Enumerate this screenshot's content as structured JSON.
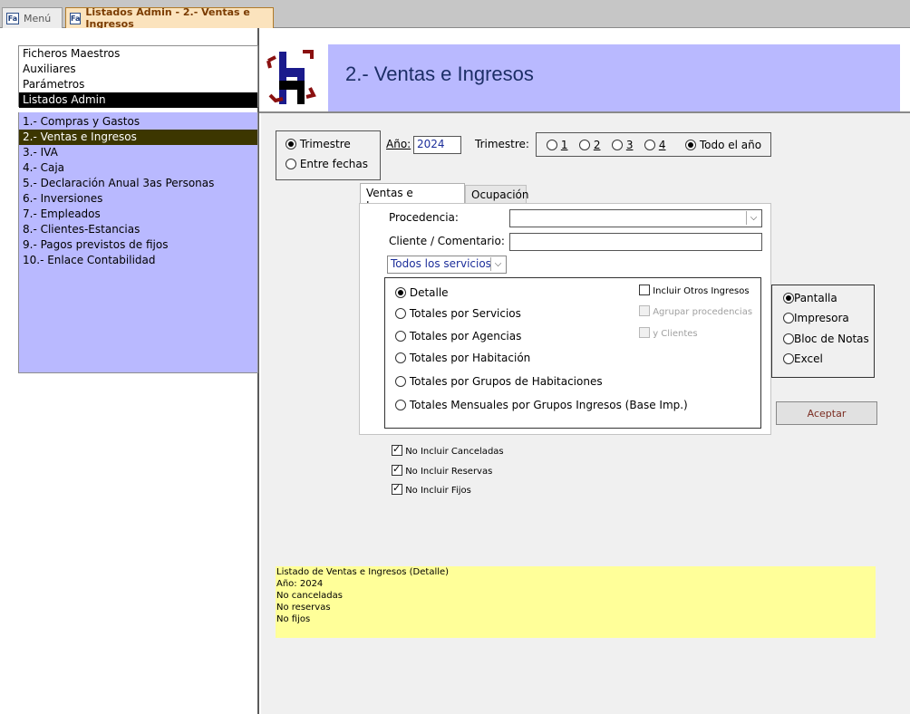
{
  "tabs": [
    {
      "label": "Menú"
    },
    {
      "label": "Listados Admin - 2.- Ventas e Ingresos"
    }
  ],
  "sidebar": {
    "main_items": [
      {
        "label": "Ficheros Maestros"
      },
      {
        "label": "Auxiliares"
      },
      {
        "label": "Parámetros"
      },
      {
        "label": "Listados Admin"
      }
    ],
    "sub_items": [
      {
        "label": "1.- Compras y Gastos"
      },
      {
        "label": "2.- Ventas e Ingresos"
      },
      {
        "label": "3.- IVA"
      },
      {
        "label": "4.- Caja"
      },
      {
        "label": "5.- Declaración Anual 3as Personas"
      },
      {
        "label": "6.- Inversiones"
      },
      {
        "label": "7.- Empleados"
      },
      {
        "label": "8.- Clientes-Estancias"
      },
      {
        "label": "9.- Pagos previstos de fijos"
      },
      {
        "label": "10.- Enlace Contabilidad"
      }
    ]
  },
  "header": {
    "title": "2.- Ventas e Ingresos"
  },
  "period": {
    "trimestre": "Trimestre",
    "entre_fechas": "Entre fechas",
    "year_label": "Año:",
    "year_value": "2024",
    "trimestre_label": "Trimestre:",
    "q1": "1",
    "q2": "2",
    "q3": "3",
    "q4": "4",
    "todo": "Todo el año"
  },
  "subtabs": {
    "ventas": "Ventas e Ingresos",
    "ocupacion": "Ocupación"
  },
  "filters": {
    "procedencia_label": "Procedencia:",
    "procedencia_value": "",
    "cliente_label": "Cliente / Comentario:",
    "cliente_value": "",
    "servicios_value": "Todos los servicios"
  },
  "report_types": [
    {
      "label": "Detalle"
    },
    {
      "label": "Totales por Servicios"
    },
    {
      "label": "Totales por Agencias"
    },
    {
      "label": "Totales por Habitación"
    },
    {
      "label": "Totales por Grupos de Habitaciones"
    },
    {
      "label": "Totales Mensuales por Grupos Ingresos (Base Imp.)"
    }
  ],
  "options": {
    "otros_ingresos": "Incluir Otros Ingresos",
    "agrupar": "Agrupar procedencias",
    "clientes": "y Clientes"
  },
  "output": {
    "pantalla": "Pantalla",
    "impresora": "Impresora",
    "bloc": "Bloc de Notas",
    "excel": "Excel"
  },
  "buttons": {
    "aceptar": "Aceptar"
  },
  "exclusions": {
    "canceladas": "No Incluir Canceladas",
    "reservas": "No Incluir Reservas",
    "fijos": "No Incluir Fijos"
  },
  "summary": [
    "Listado de Ventas e Ingresos (Detalle)",
    "Año: 2024",
    "No canceladas",
    "No reservas",
    "No fijos"
  ],
  "colors": {
    "header_bg": "#b9b9ff",
    "selected_sub": "#3c3600",
    "summary_bg": "#ffff99"
  }
}
